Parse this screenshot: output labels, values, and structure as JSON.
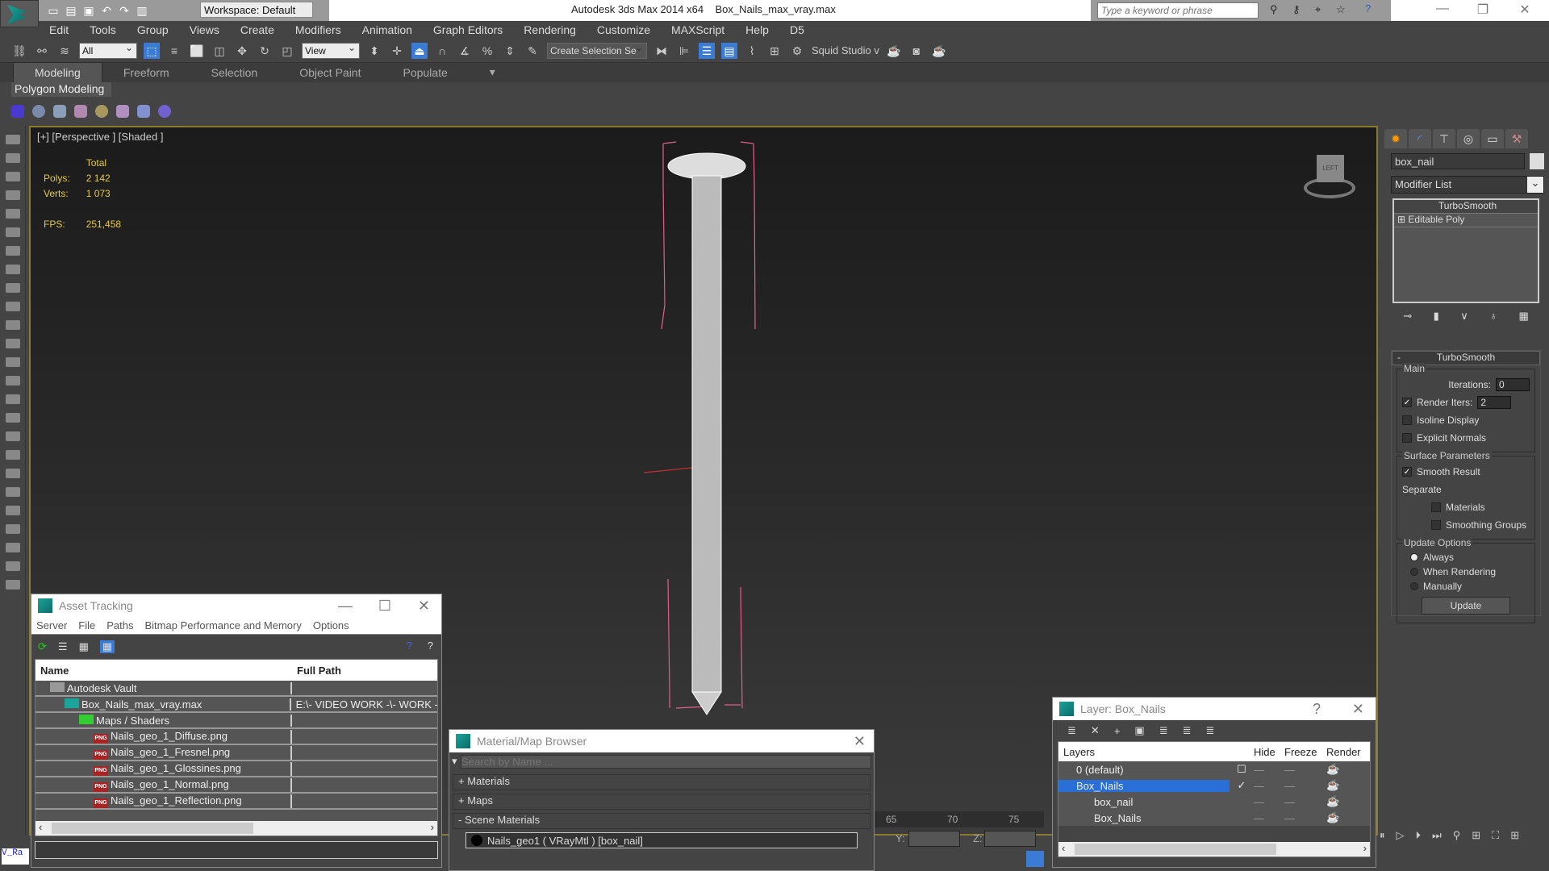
{
  "title": {
    "app": "Autodesk 3ds Max  2014 x64",
    "file": "Box_Nails_max_vray.max",
    "workspace": "Workspace: Default",
    "search_placeholder": "Type a keyword or phrase"
  },
  "menu": [
    "Edit",
    "Tools",
    "Group",
    "Views",
    "Create",
    "Modifiers",
    "Animation",
    "Graph Editors",
    "Rendering",
    "Customize",
    "MAXScript",
    "Help",
    "D5"
  ],
  "toolbar": {
    "filter": "All",
    "ref_coord": "View",
    "selection_set": "Create Selection Se",
    "plugin": "Squid Studio v"
  },
  "ribbon": {
    "tabs": [
      "Modeling",
      "Freeform",
      "Selection",
      "Object Paint",
      "Populate"
    ],
    "active": "Modeling",
    "panel": "Polygon Modeling"
  },
  "viewport": {
    "label": "[+] [Perspective ] [Shaded ]",
    "stats_header": "Total",
    "polys_label": "Polys:",
    "polys": "2 142",
    "verts_label": "Verts:",
    "verts": "1 073",
    "fps_label": "FPS:",
    "fps": "251,458",
    "viewcube": "LEFT"
  },
  "command_panel": {
    "object_name": "box_nail",
    "modifier_list": "Modifier List",
    "stack": [
      "TurboSmooth",
      "Editable Poly"
    ],
    "rollout": "TurboSmooth",
    "main_group": "Main",
    "iterations_label": "Iterations:",
    "iterations": "0",
    "render_iters_label": "Render Iters:",
    "render_iters": "2",
    "isoline": "Isoline Display",
    "explicit_normals": "Explicit Normals",
    "surface_group": "Surface Parameters",
    "smooth_result": "Smooth Result",
    "separate": "Separate",
    "materials": "Materials",
    "smoothing_groups": "Smoothing Groups",
    "update_group": "Update Options",
    "always": "Always",
    "when_rendering": "When Rendering",
    "manually": "Manually",
    "update_btn": "Update"
  },
  "asset_tracking": {
    "title": "Asset Tracking",
    "menu": [
      "Server",
      "File",
      "Paths",
      "Bitmap Performance and Memory",
      "Options"
    ],
    "columns": [
      "Name",
      "Full Path"
    ],
    "rows": [
      {
        "name": "Autodesk Vault",
        "path": "",
        "indent": 1,
        "icon": "vault"
      },
      {
        "name": "Box_Nails_max_vray.max",
        "path": "E:\\- VIDEO WORK -\\- WORK -",
        "indent": 2,
        "icon": "max"
      },
      {
        "name": "Maps / Shaders",
        "path": "",
        "indent": 3,
        "icon": "maps"
      },
      {
        "name": "Nails_geo_1_Diffuse.png",
        "path": "",
        "indent": 4,
        "icon": "png"
      },
      {
        "name": "Nails_geo_1_Fresnel.png",
        "path": "",
        "indent": 4,
        "icon": "png"
      },
      {
        "name": "Nails_geo_1_Glossines.png",
        "path": "",
        "indent": 4,
        "icon": "png"
      },
      {
        "name": "Nails_geo_1_Normal.png",
        "path": "",
        "indent": 4,
        "icon": "png"
      },
      {
        "name": "Nails_geo_1_Reflection.png",
        "path": "",
        "indent": 4,
        "icon": "png"
      }
    ]
  },
  "material_browser": {
    "title": "Material/Map Browser",
    "search_placeholder": "Search by Name ...",
    "sections": [
      "+ Materials",
      "+ Maps",
      "- Scene Materials"
    ],
    "item": "Nails_geo1  ( VRayMtl ) [box_nail]"
  },
  "layer_dialog": {
    "title": "Layer: Box_Nails",
    "help": "?",
    "columns": [
      "Layers",
      "",
      "Hide",
      "Freeze",
      "Render"
    ],
    "rows": [
      {
        "name": "0 (default)",
        "indent": 1,
        "active": false
      },
      {
        "name": "Box_Nails",
        "indent": 1,
        "active": true
      },
      {
        "name": "box_nail",
        "indent": 2,
        "active": false
      },
      {
        "name": "Box_Nails",
        "indent": 2,
        "active": false
      }
    ]
  },
  "timeline": {
    "ticks": [
      "65",
      "70",
      "75"
    ],
    "y_label": "Y:",
    "z_label": "Z:"
  },
  "maxscript": "V_Ra"
}
